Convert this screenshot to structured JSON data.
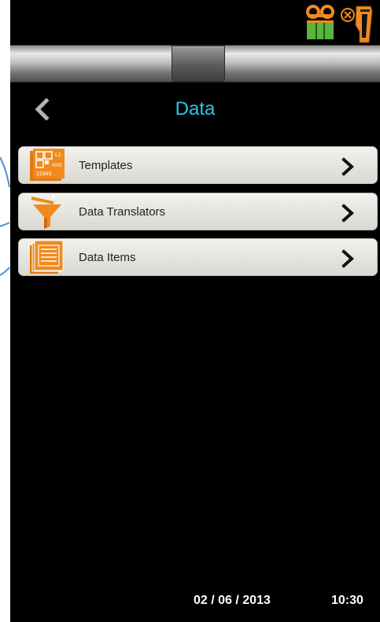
{
  "header": {
    "title": "Data"
  },
  "menu": {
    "items": [
      {
        "label": "Templates",
        "icon": "barcode-template-icon"
      },
      {
        "label": "Data Translators",
        "icon": "funnel-icon"
      },
      {
        "label": "Data Items",
        "icon": "document-list-icon"
      }
    ]
  },
  "template_icon_text": {
    "l1": "L1",
    "num": "0001",
    "code": "12345"
  },
  "status": {
    "icons": [
      "tape-recorder-icon",
      "scanner-disconnected-icon"
    ]
  },
  "footer": {
    "date": "02 / 06 / 2013",
    "time": "10:30"
  },
  "colors": {
    "accent": "#28c8e8",
    "orange": "#f08a1f",
    "green": "#59b53b",
    "callout": "#4a90d0"
  }
}
